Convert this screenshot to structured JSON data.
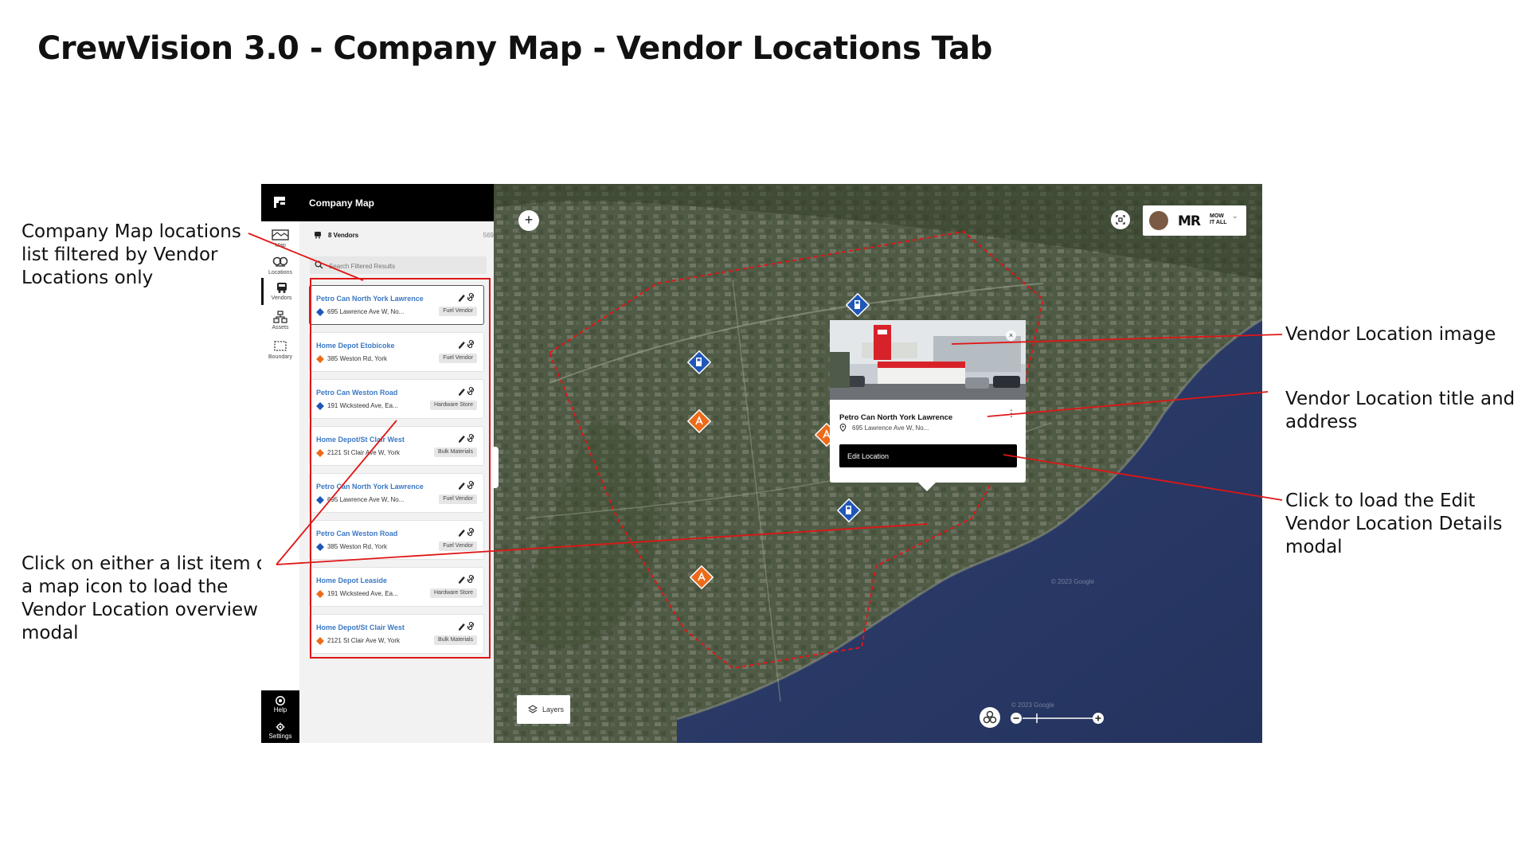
{
  "page": {
    "title": "CrewVision 3.0 - Company Map - Vendor Locations Tab"
  },
  "annotations": {
    "list_filtered": [
      "Company Map locations",
      "list filtered by Vendor",
      "Locations only"
    ],
    "click_item": [
      "Click on either a list item or",
      "a map icon to load the",
      "Vendor Location overview",
      "modal"
    ],
    "location_image": [
      "Vendor Location image"
    ],
    "title_address": [
      "Vendor Location title and",
      "address"
    ],
    "edit_modal": [
      "Click to load the Edit",
      "Vendor Location Details",
      "modal"
    ]
  },
  "sidebar": {
    "nav": [
      {
        "label": "Map",
        "icon": "map-icon"
      },
      {
        "label": "Locations",
        "icon": "locations-icon"
      },
      {
        "label": "Vendors",
        "icon": "vendors-icon"
      },
      {
        "label": "Assets",
        "icon": "assets-icon"
      },
      {
        "label": "Boundary",
        "icon": "boundary-icon"
      }
    ],
    "footer": [
      {
        "label": "Help",
        "icon": "help-icon"
      },
      {
        "label": "Settings",
        "icon": "settings-icon"
      }
    ]
  },
  "panel": {
    "title": "Company Map",
    "collapse_glyph": "«",
    "filter": {
      "label": "8 Vendors",
      "count": "569"
    },
    "search_placeholder": "Search Filtered Results",
    "items": [
      {
        "name": "Petro Can North York Lawrence",
        "address": "695 Lawrence Ave W, No...",
        "category": "Fuel Vendor",
        "pin": "blue"
      },
      {
        "name": "Home Depot Etobicoke",
        "address": "385 Weston Rd, York",
        "category": "Fuel Vendor",
        "pin": "orange"
      },
      {
        "name": "Petro Can Weston Road",
        "address": "191 Wicksteed Ave, Ea...",
        "category": "Hardware Store",
        "pin": "blue"
      },
      {
        "name": "Home Depot/St Clair West",
        "address": "2121 St Clair Ave W, York",
        "category": "Bulk Materials",
        "pin": "orange"
      },
      {
        "name": "Petro Can North York Lawrence",
        "address": "695 Lawrence Ave W, No...",
        "category": "Fuel Vendor",
        "pin": "blue"
      },
      {
        "name": "Petro Can Weston Road",
        "address": "385 Weston Rd, York",
        "category": "Fuel Vendor",
        "pin": "blue"
      },
      {
        "name": "Home Depot Leaside",
        "address": "191 Wicksteed Ave, Ea...",
        "category": "Hardware Store",
        "pin": "orange"
      },
      {
        "name": "Home Depot/St Clair West",
        "address": "2121 St Clair Ave W, York",
        "category": "Bulk Materials",
        "pin": "orange"
      }
    ]
  },
  "map": {
    "user": {
      "brand": "MR",
      "brand_sub": "MOW IT ALL",
      "caret": "⌄"
    },
    "zoom_in_glyph": "+",
    "popup": {
      "title": "Petro Can North York Lawrence",
      "address": "695 Lawrence Ave W, No...",
      "edit_label": "Edit Location",
      "close_glyph": "×",
      "more_glyph": "⋮"
    },
    "layers_label": "Layers",
    "watermarks": [
      "© 2023 Google",
      "© 2023 Google"
    ]
  },
  "colors": {
    "accent_red": "#e01616",
    "pin_blue": "#1f56b8",
    "pin_orange": "#ec6b1a",
    "link_blue": "#3b78c4"
  }
}
